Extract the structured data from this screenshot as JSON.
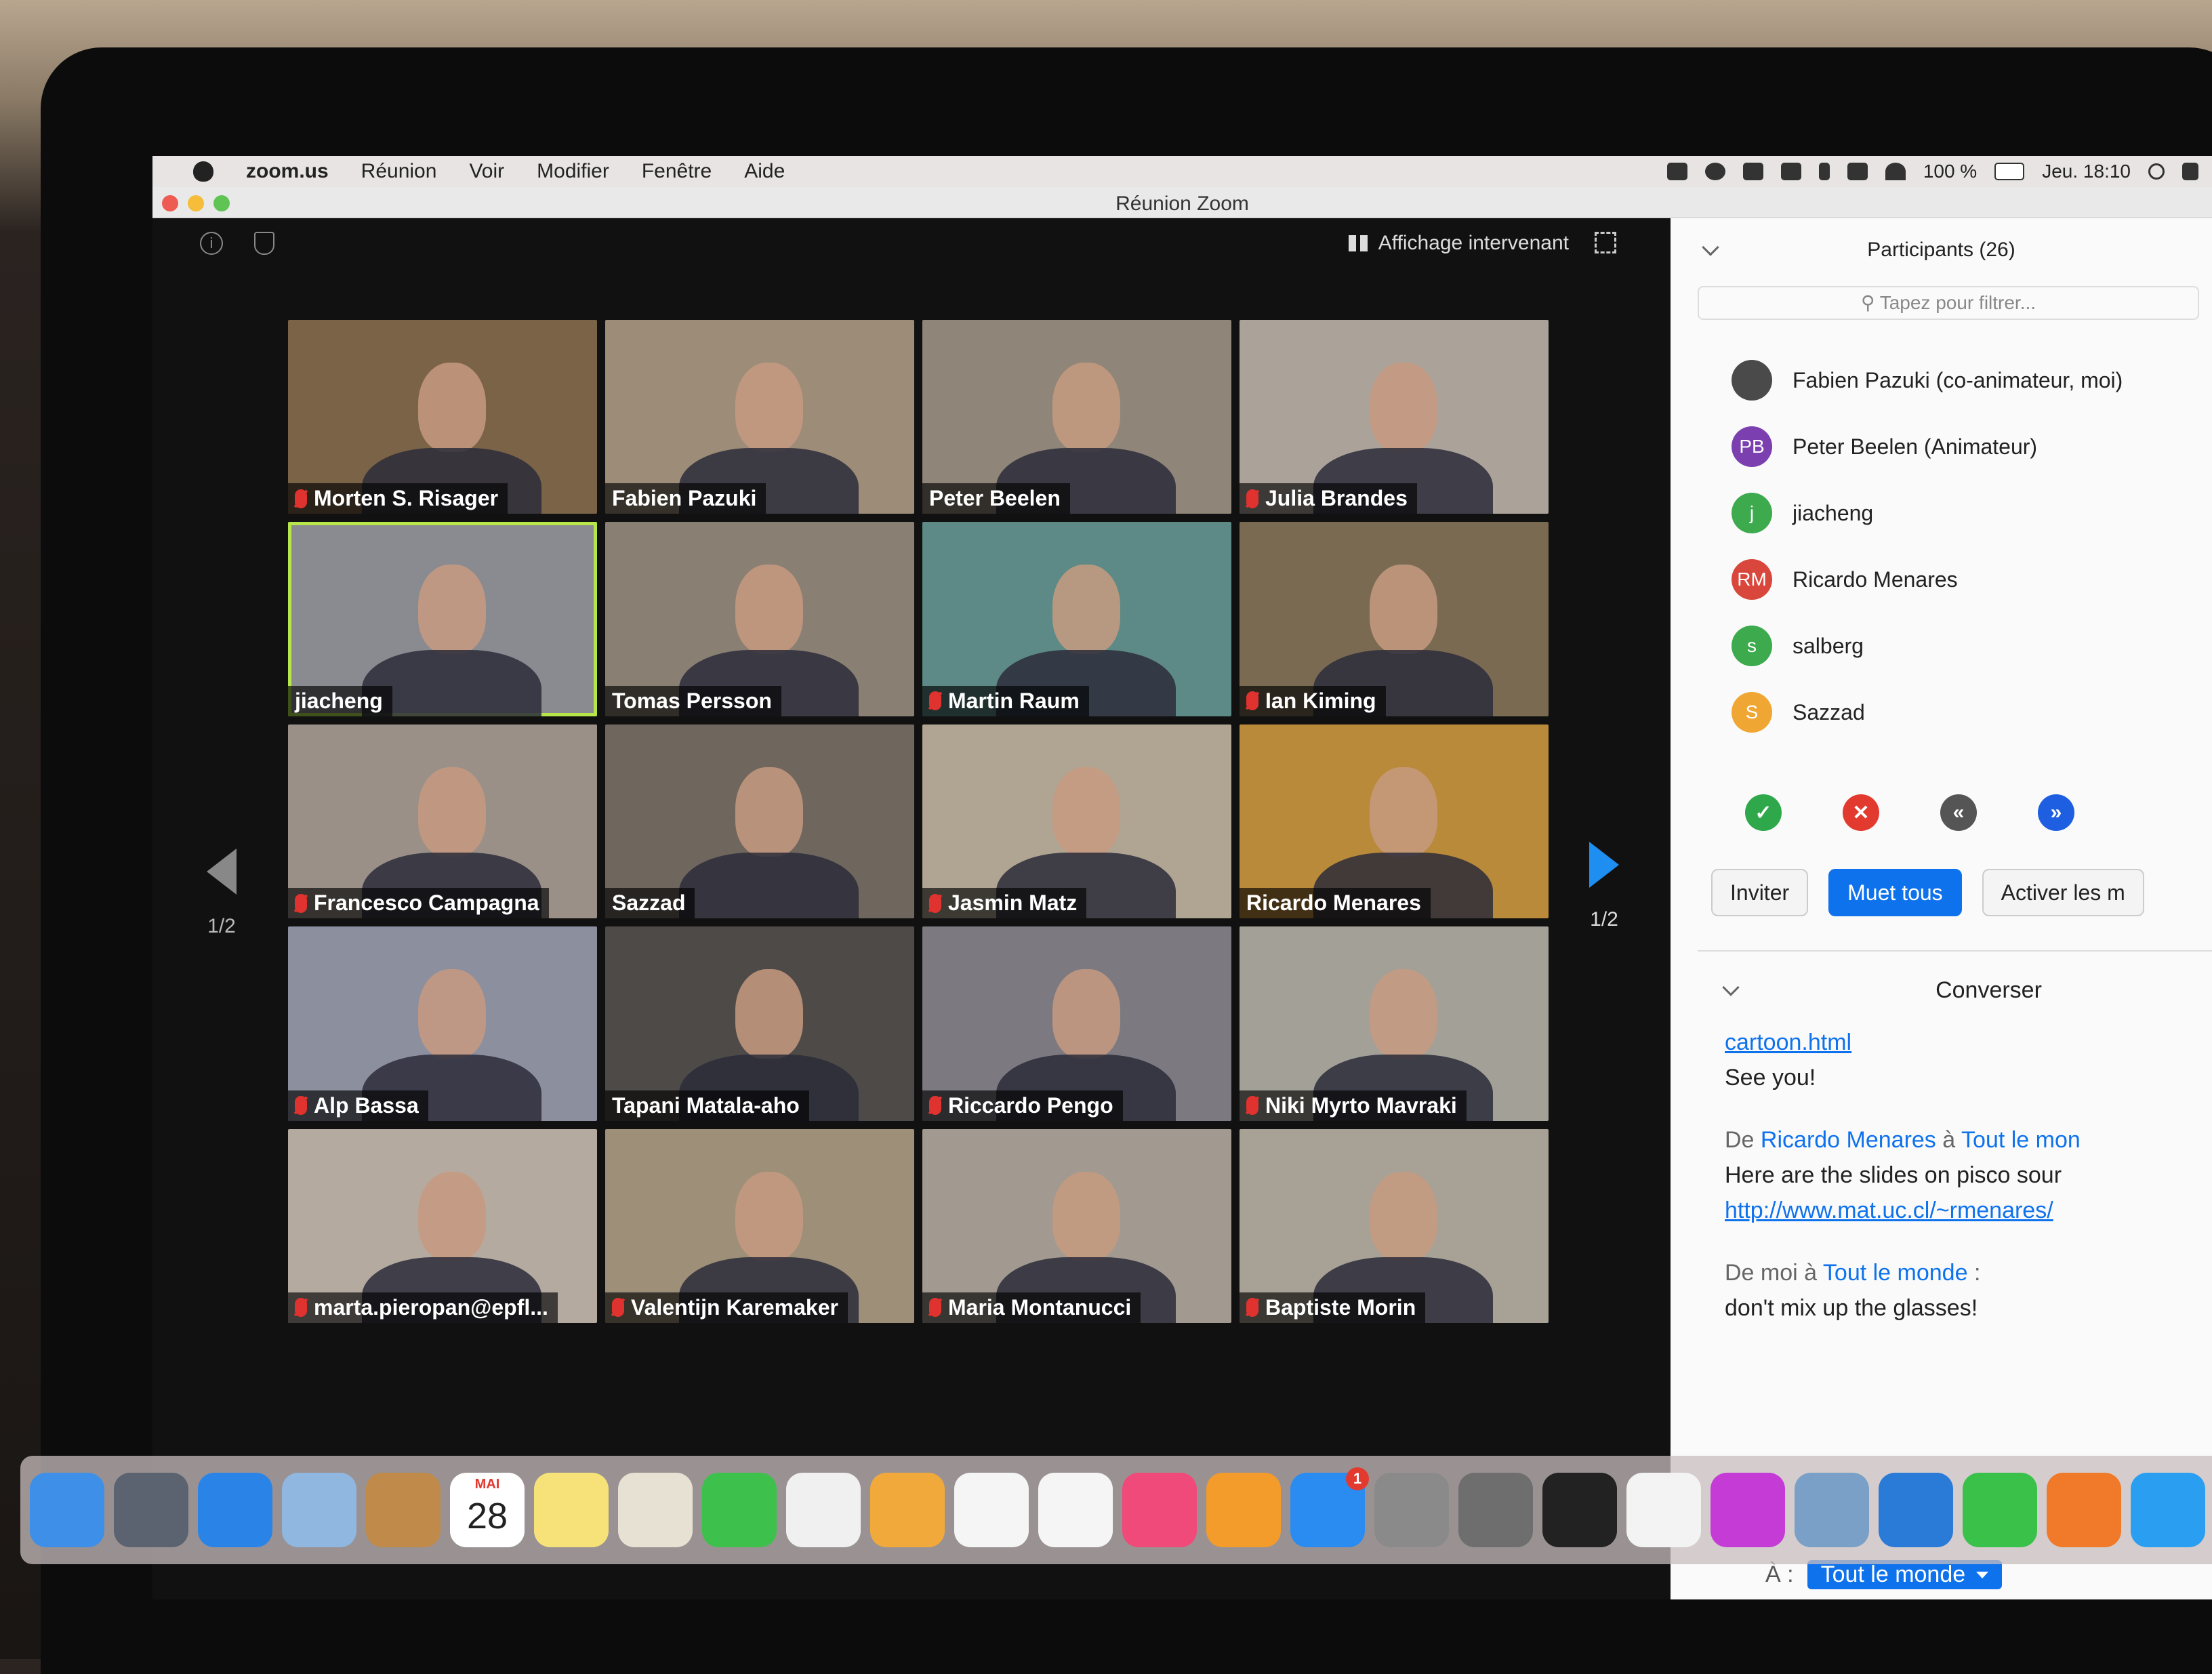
{
  "menubar": {
    "app_name": "zoom.us",
    "menus": [
      "Réunion",
      "Voir",
      "Modifier",
      "Fenêtre",
      "Aide"
    ],
    "battery": "100 %",
    "clock": "Jeu. 18:10"
  },
  "window": {
    "title": "Réunion Zoom"
  },
  "video": {
    "view_label": "Affichage intervenant",
    "page_left": "1/2",
    "page_right": "1/2",
    "tiles": [
      {
        "name": "Morten S. Risager",
        "muted": true,
        "bg": "#7a6347"
      },
      {
        "name": "Fabien Pazuki",
        "muted": false,
        "bg": "#9c8c78"
      },
      {
        "name": "Peter Beelen",
        "muted": false,
        "bg": "#8f8579"
      },
      {
        "name": "Julia Brandes",
        "muted": true,
        "bg": "#aba39a"
      },
      {
        "name": "jiacheng",
        "muted": false,
        "bg": "#8a8b91"
      },
      {
        "name": "Tomas Persson",
        "muted": false,
        "bg": "#8a7f73"
      },
      {
        "name": "Martin Raum",
        "muted": true,
        "bg": "#5d8a86"
      },
      {
        "name": "Ian Kiming",
        "muted": true,
        "bg": "#7a6a52"
      },
      {
        "name": "Francesco Campagna",
        "muted": true,
        "bg": "#9a9088"
      },
      {
        "name": "Sazzad",
        "muted": false,
        "bg": "#6f675e"
      },
      {
        "name": "Jasmin Matz",
        "muted": true,
        "bg": "#b0a593"
      },
      {
        "name": "Ricardo Menares",
        "muted": false,
        "bg": "#b98a3a"
      },
      {
        "name": "Alp Bassa",
        "muted": true,
        "bg": "#8c8f9e"
      },
      {
        "name": "Tapani Matala-aho",
        "muted": false,
        "bg": "#4e4a48"
      },
      {
        "name": "Riccardo Pengo",
        "muted": true,
        "bg": "#7c7a80"
      },
      {
        "name": "Niki Myrto Mavraki",
        "muted": true,
        "bg": "#a3a097"
      },
      {
        "name": "marta.pieropan@epfl...",
        "muted": true,
        "bg": "#b4aaa0"
      },
      {
        "name": "Valentijn Karemaker",
        "muted": true,
        "bg": "#9d8f78"
      },
      {
        "name": "Maria Montanucci",
        "muted": true,
        "bg": "#a29a90"
      },
      {
        "name": "Baptiste Morin",
        "muted": true,
        "bg": "#a8a196"
      }
    ]
  },
  "participants": {
    "header": "Participants (26)",
    "filter_placeholder": "Tapez pour filtrer...",
    "list": [
      {
        "initials": "",
        "name": "Fabien Pazuki (co-animateur, moi)",
        "color": "#4a4a4a"
      },
      {
        "initials": "PB",
        "name": "Peter Beelen (Animateur)",
        "color": "#7b3fb0"
      },
      {
        "initials": "j",
        "name": "jiacheng",
        "color": "#3daa4e"
      },
      {
        "initials": "RM",
        "name": "Ricardo Menares",
        "color": "#d9463b"
      },
      {
        "initials": "s",
        "name": "salberg",
        "color": "#3daa4e"
      },
      {
        "initials": "S",
        "name": "Sazzad",
        "color": "#f0a632"
      }
    ],
    "reactions": [
      {
        "symbol": "✓",
        "color": "#2ea84a",
        "icon": "yes-icon"
      },
      {
        "symbol": "✕",
        "color": "#e23a2f",
        "icon": "no-icon"
      },
      {
        "symbol": "«",
        "color": "#555555",
        "icon": "slower-icon"
      },
      {
        "symbol": "»",
        "color": "#1d5fe0",
        "icon": "faster-icon"
      }
    ],
    "buttons": {
      "invite": "Inviter",
      "mute_all": "Muet tous",
      "unmute_all": "Activer les m"
    }
  },
  "chat": {
    "header": "Converser",
    "link1": "cartoon.html",
    "msg1": "See you!",
    "meta2_from": "De",
    "meta2_sender": "Ricardo Menares",
    "meta2_to": "à",
    "meta2_target": "Tout le mon",
    "msg2": "Here are the slides on pisco sour",
    "link2": "http://www.mat.uc.cl/~rmenares/",
    "meta3_from": "De moi à",
    "meta3_target": "Tout le monde",
    "meta3_colon": ":",
    "msg3": "don't mix up the glasses!",
    "to_label": "À :",
    "to_value": "Tout le monde"
  },
  "dock": {
    "calendar_month": "MAI",
    "calendar_day": "28",
    "appstore_badge": "1",
    "items": [
      {
        "icon": "finder-icon",
        "color": "#3d8fe8"
      },
      {
        "icon": "launchpad-icon",
        "color": "#5b6370"
      },
      {
        "icon": "safari-icon",
        "color": "#2a84e8"
      },
      {
        "icon": "mail-icon",
        "color": "#8fb7e0"
      },
      {
        "icon": "contacts-icon",
        "color": "#c08a4a"
      },
      {
        "icon": "calendar-icon",
        "color": "#ffffff"
      },
      {
        "icon": "notes-icon",
        "color": "#f7e27a"
      },
      {
        "icon": "preview-icon",
        "color": "#e6e1d3"
      },
      {
        "icon": "facetime-icon",
        "color": "#3dc14c"
      },
      {
        "icon": "photos-icon",
        "color": "#f0f0f0"
      },
      {
        "icon": "pages-icon",
        "color": "#f2a93b"
      },
      {
        "icon": "numbers-icon",
        "color": "#f5f5f5"
      },
      {
        "icon": "keynote-icon",
        "color": "#f5f5f5"
      },
      {
        "icon": "itunes-icon",
        "color": "#f04a7a"
      },
      {
        "icon": "books-icon",
        "color": "#f39b2b"
      },
      {
        "icon": "appstore-icon",
        "color": "#2a8cf0"
      },
      {
        "icon": "system-preferences-icon",
        "color": "#8a8a8a"
      },
      {
        "icon": "tex-icon",
        "color": "#6e6e6e"
      },
      {
        "icon": "terminal-icon",
        "color": "#222222"
      },
      {
        "icon": "textedit-icon",
        "color": "#f3f3f3"
      },
      {
        "icon": "flower-app-icon",
        "color": "#c43bd6"
      },
      {
        "icon": "image-capture-icon",
        "color": "#7aa0c8"
      },
      {
        "icon": "testflight-icon",
        "color": "#2a7ad8"
      },
      {
        "icon": "line-icon",
        "color": "#39c14a"
      },
      {
        "icon": "firefox-icon",
        "color": "#f07a2a"
      },
      {
        "icon": "skype-icon",
        "color": "#2a9ef0"
      },
      {
        "icon": "zoom-icon",
        "color": "#2d8cff"
      }
    ]
  }
}
